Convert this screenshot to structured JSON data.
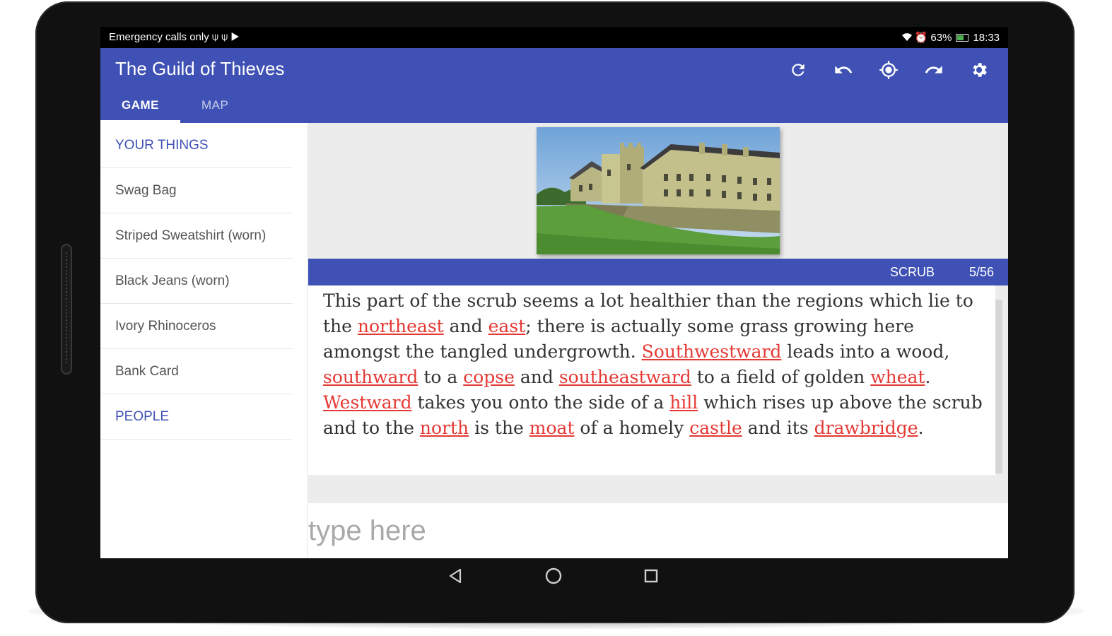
{
  "status_bar": {
    "left_text": "Emergency calls only",
    "left_icons": [
      "usb-icon",
      "usb-icon",
      "play-store-icon"
    ],
    "battery_percent": "63%",
    "time": "18:33",
    "right_icons": [
      "wifi-icon",
      "alarm-icon",
      "battery-icon"
    ]
  },
  "app": {
    "title": "The Guild of Thieves",
    "accent_color": "#3f51b5",
    "actions": [
      {
        "name": "refresh",
        "icon": "refresh-icon"
      },
      {
        "name": "undo",
        "icon": "undo-icon"
      },
      {
        "name": "locate",
        "icon": "gps-target-icon"
      },
      {
        "name": "redo",
        "icon": "redo-icon"
      },
      {
        "name": "settings",
        "icon": "gear-icon"
      }
    ],
    "tabs": [
      {
        "label": "GAME",
        "active": true
      },
      {
        "label": "MAP",
        "active": false
      }
    ]
  },
  "sidebar": {
    "items": [
      {
        "label": "YOUR THINGS",
        "header": true
      },
      {
        "label": "Swag Bag"
      },
      {
        "label": "Striped Sweatshirt (worn)"
      },
      {
        "label": "Black Jeans (worn)"
      },
      {
        "label": "Ivory Rhinoceros"
      },
      {
        "label": "Bank Card"
      },
      {
        "label": "PEOPLE",
        "header": true
      }
    ]
  },
  "location": {
    "name": "SCRUB",
    "counter": "5/56",
    "image_icon": "castle-scene-image"
  },
  "story": {
    "segments": [
      {
        "text": "This part of the scrub seems a lot healthier than the regions which lie to the "
      },
      {
        "text": "northeast",
        "link": true
      },
      {
        "text": " and "
      },
      {
        "text": "east",
        "link": true
      },
      {
        "text": "; there is actually some grass growing here amongst the tangled undergrowth. "
      },
      {
        "text": "Southwestward",
        "link": true
      },
      {
        "text": " leads into a wood, "
      },
      {
        "text": "southward",
        "link": true
      },
      {
        "text": " to a "
      },
      {
        "text": "copse",
        "link": true
      },
      {
        "text": " and "
      },
      {
        "text": "southeastward",
        "link": true
      },
      {
        "text": " to a field of golden "
      },
      {
        "text": "wheat",
        "link": true
      },
      {
        "text": ". "
      },
      {
        "text": "Westward",
        "link": true
      },
      {
        "text": " takes you onto the side of a "
      },
      {
        "text": "hill",
        "link": true
      },
      {
        "text": " which rises up above the scrub and to the "
      },
      {
        "text": "north",
        "link": true
      },
      {
        "text": " is the "
      },
      {
        "text": "moat",
        "link": true
      },
      {
        "text": " of a homely "
      },
      {
        "text": "castle",
        "link": true
      },
      {
        "text": " and its "
      },
      {
        "text": "drawbridge",
        "link": true
      },
      {
        "text": "."
      }
    ],
    "link_color": "#e53935"
  },
  "command": {
    "value": "",
    "placeholder": "type here"
  },
  "nav_bar": {
    "buttons": [
      "back-icon",
      "home-icon",
      "recents-icon"
    ]
  }
}
